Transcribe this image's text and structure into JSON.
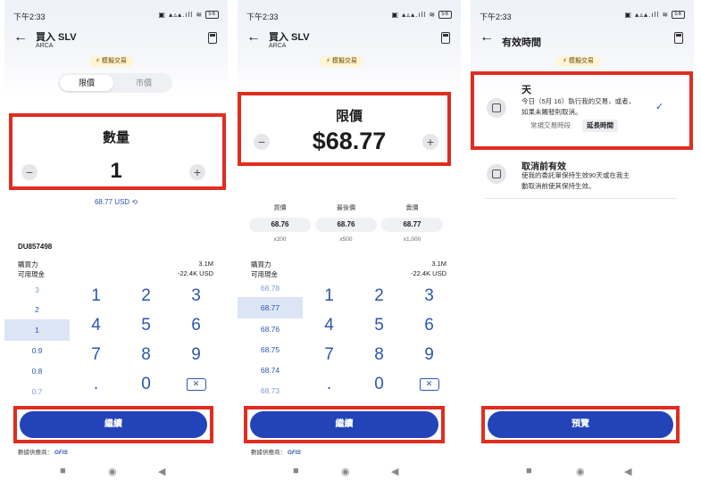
{
  "status": {
    "time": "下午2:33",
    "icons": "▣ ▴▵▴.ıll ≋",
    "battery": "56"
  },
  "panel1": {
    "title": "買入 SLV",
    "subtitle": "ARCA",
    "badge": "模擬交易",
    "tabs": [
      {
        "label": "限價",
        "active": true
      },
      {
        "label": "市價",
        "active": false
      }
    ],
    "qty_title": "數量",
    "qty_value": "1",
    "usd_value": "68.77 USD",
    "account_id": "DU857498",
    "buying_power_label": "購買力",
    "buying_power_value": "3.1M",
    "cash_label": "可用現金",
    "cash_value": "-22.4K USD",
    "wheel": [
      "3",
      "2",
      "1",
      "0.9",
      "0.8",
      "0.7"
    ],
    "wheel_selected": "1",
    "keypad": [
      "1",
      "2",
      "3",
      "4",
      "5",
      "6",
      "7",
      "8",
      "9",
      ".",
      "0"
    ],
    "continue_label": "繼續",
    "provider_label": "數據供應商：",
    "provider_name": "GFIS"
  },
  "panel2": {
    "title": "買入 SLV",
    "subtitle": "ARCA",
    "badge": "模擬交易",
    "limit_title": "限價",
    "limit_value": "$68.77",
    "quotes": [
      {
        "label": "買價",
        "price": "68.76",
        "size": "x200"
      },
      {
        "label": "最後價",
        "price": "68.76",
        "size": "x500"
      },
      {
        "label": "賣價",
        "price": "68.77",
        "size": "x1,000"
      }
    ],
    "buying_power_label": "購買力",
    "buying_power_value": "3.1M",
    "cash_label": "可用現金",
    "cash_value": "-22.4K USD",
    "wheel": [
      "68.78",
      "68.77",
      "68.76",
      "68.75",
      "68.74",
      "68.73"
    ],
    "wheel_selected": "68.77",
    "keypad": [
      "1",
      "2",
      "3",
      "4",
      "5",
      "6",
      "7",
      "8",
      "9",
      ".",
      "0"
    ],
    "continue_label": "繼續",
    "provider_label": "數據供應商：",
    "provider_name": "GFIS"
  },
  "panel3": {
    "title": "有效時間",
    "badge": "模擬交易",
    "option1_title": "天",
    "option1_desc1": "今日（5月 16）執行我的交易，或者，",
    "option1_desc2": "如果未觸發則取消。",
    "chip_regular": "常規交易時段",
    "chip_extended": "延長時間",
    "option2_title": "取消前有效",
    "option2_desc1": "使我的委託單保持生效90天或在我主",
    "option2_desc2": "動取消前使其保持生效。",
    "preview_label": "預覽"
  },
  "navbar": {
    "home": "■",
    "circle": "◉",
    "back": "◀"
  },
  "colors": {
    "primary": "#2344b8",
    "highlight": "#e02d20",
    "accent": "#2b56b3"
  }
}
